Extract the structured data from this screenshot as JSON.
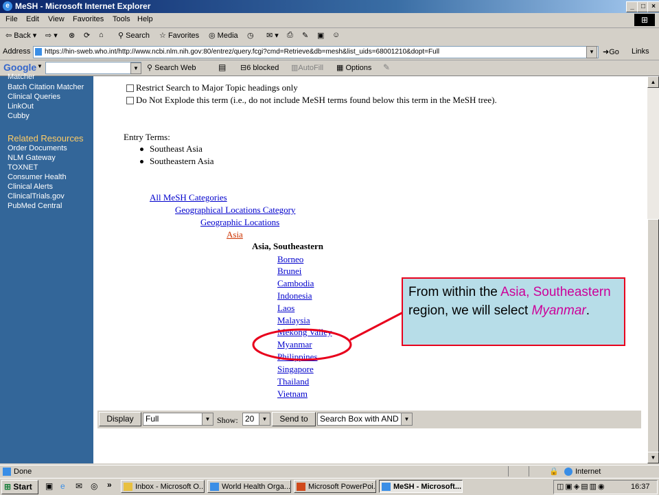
{
  "window": {
    "title": "MeSH - Microsoft Internet Explorer"
  },
  "menu": [
    "File",
    "Edit",
    "View",
    "Favorites",
    "Tools",
    "Help"
  ],
  "toolbar": {
    "back": "Back",
    "search": "Search",
    "favorites": "Favorites",
    "media": "Media"
  },
  "address": {
    "label": "Address",
    "url": "https://hin-sweb.who.int/http://www.ncbi.nlm.nih.gov:80/entrez/query.fcgi?cmd=Retrieve&db=mesh&list_uids=68001210&dopt=Full",
    "go": "Go",
    "links": "Links"
  },
  "googlebar": {
    "brand": "Google",
    "search_web": "Search Web",
    "blocked": "6 blocked",
    "autofill": "AutoFill",
    "options": "Options"
  },
  "sidebar": {
    "items_top": [
      "Matcher",
      "Batch Citation Matcher",
      "Clinical Queries",
      "LinkOut",
      "Cubby"
    ],
    "related_heading": "Related Resources",
    "items_related": [
      "Order Documents",
      "NLM Gateway",
      "TOXNET",
      "Consumer Health",
      "Clinical Alerts",
      "ClinicalTrials.gov",
      "PubMed Central"
    ]
  },
  "content": {
    "restrict_label": "Restrict Search to Major Topic headings only",
    "no_explode_label": "Do Not Explode this term (i.e., do not include MeSH terms found below this term in the MeSH tree).",
    "entry_terms_label": "Entry Terms:",
    "entry_terms": [
      "Southeast Asia",
      "Southeastern Asia"
    ],
    "tree": {
      "all": "All MeSH Categories",
      "geo_cat": "Geographical Locations Category",
      "geo_loc": "Geographic Locations",
      "asia": "Asia",
      "current": "Asia, Southeastern",
      "children": [
        "Borneo",
        "Brunei",
        "Cambodia",
        "Indonesia",
        "Laos",
        "Malaysia",
        "Mekong Valley",
        "Myanmar",
        "Philippines",
        "Singapore",
        "Thailand",
        "Vietnam"
      ]
    }
  },
  "bottom": {
    "display_btn": "Display",
    "format": "Full",
    "show_label": "Show:",
    "show_value": "20",
    "send_btn": "Send to",
    "send_target": "Search Box with AND"
  },
  "callout": {
    "p1": "From within the ",
    "p2": "Asia, Southeastern",
    "p3": " region, we will select ",
    "p4": "Myanmar",
    "p5": "."
  },
  "status": {
    "text": "Done",
    "zone": "Internet"
  },
  "taskbar": {
    "start": "Start",
    "tasks": [
      "Inbox - Microsoft O...",
      "World Health Orga...",
      "Microsoft PowerPoi...",
      "MeSH - Microsoft..."
    ],
    "clock": "16:37"
  },
  "colors": {
    "sidebar_bg": "#336699",
    "link": "#0000cc",
    "visited": "#cc3300",
    "callout_bg": "#b7dde8",
    "callout_border": "#e8001c",
    "highlight": "#cc0099"
  }
}
